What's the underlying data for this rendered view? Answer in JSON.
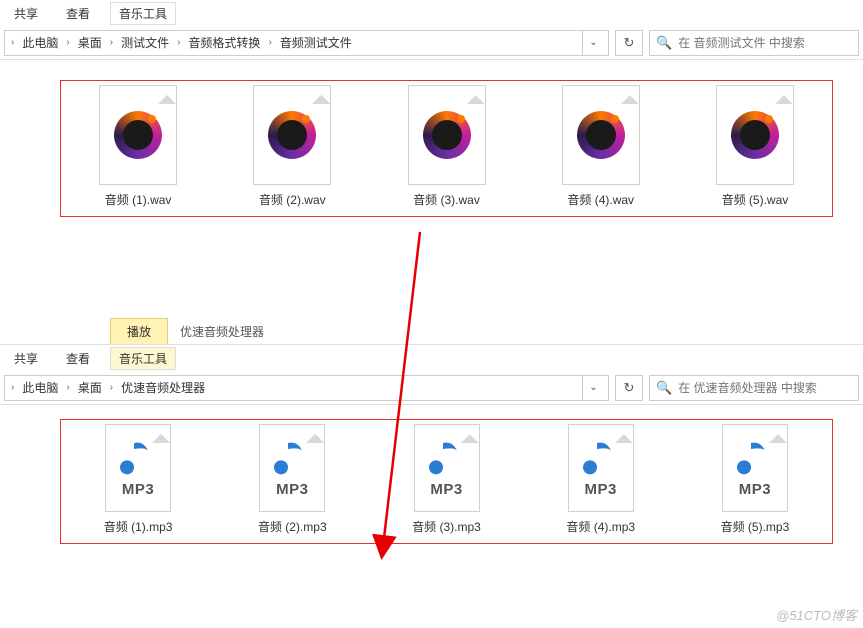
{
  "top": {
    "tabs": {
      "share": "共享",
      "view": "查看"
    },
    "music_tools": "音乐工具",
    "breadcrumb": [
      "此电脑",
      "桌面",
      "测试文件",
      "音频格式转换",
      "音频测试文件"
    ],
    "search_placeholder": "在 音频测试文件 中搜索",
    "files": [
      {
        "name": "音频 (1).wav"
      },
      {
        "name": "音频 (2).wav"
      },
      {
        "name": "音频 (3).wav"
      },
      {
        "name": "音频 (4).wav"
      },
      {
        "name": "音频 (5).wav"
      }
    ]
  },
  "bottom": {
    "play_tab": "播放",
    "tool_label": "优速音频处理器",
    "tabs": {
      "share": "共享",
      "view": "查看"
    },
    "music_tools": "音乐工具",
    "breadcrumb": [
      "此电脑",
      "桌面",
      "优速音频处理器"
    ],
    "search_placeholder": "在 优速音频处理器 中搜索",
    "mp3_label": "MP3",
    "files": [
      {
        "name": "音频 (1).mp3"
      },
      {
        "name": "音频 (2).mp3"
      },
      {
        "name": "音频 (3).mp3"
      },
      {
        "name": "音频 (4).mp3"
      },
      {
        "name": "音频 (5).mp3"
      }
    ]
  },
  "watermark": "@51CTO博客"
}
